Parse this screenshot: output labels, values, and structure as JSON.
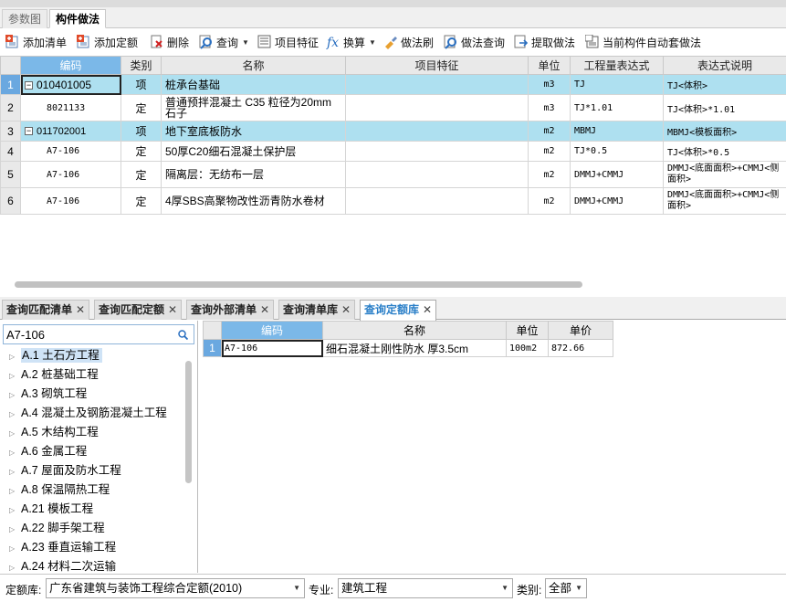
{
  "top_tabs": [
    "参数图",
    "构件做法"
  ],
  "toolbar": {
    "add_list": "添加清单",
    "add_quota": "添加定额",
    "delete": "删除",
    "query": "查询",
    "item_feature": "项目特征",
    "convert": "换算",
    "method_brush": "做法刷",
    "method_query": "做法查询",
    "extract_method": "提取做法",
    "auto_apply": "当前构件自动套做法"
  },
  "main_grid": {
    "columns": [
      "编码",
      "类别",
      "名称",
      "项目特征",
      "单位",
      "工程量表达式",
      "表达式说明"
    ],
    "rows": [
      {
        "num": "1",
        "code": "010401005",
        "type": "项",
        "name": "桩承台基础",
        "feature": "",
        "unit": "m3",
        "expr": "TJ",
        "desc": "TJ<体积>"
      },
      {
        "num": "2",
        "code": "8021133",
        "type": "定",
        "name": "普通预拌混凝土 C35 粒径为20mm石子",
        "feature": "",
        "unit": "m3",
        "expr": "TJ*1.01",
        "desc": "TJ<体积>*1.01"
      },
      {
        "num": "3",
        "code": "011702001",
        "type": "项",
        "name": "地下室底板防水",
        "feature": "",
        "unit": "m2",
        "expr": "MBMJ",
        "desc": "MBMJ<模板面积>"
      },
      {
        "num": "4",
        "code": "A7-106",
        "type": "定",
        "name": "50厚C20细石混凝土保护层",
        "feature": "",
        "unit": "m2",
        "expr": "TJ*0.5",
        "desc": "TJ<体积>*0.5"
      },
      {
        "num": "5",
        "code": "A7-106",
        "type": "定",
        "name": "隔离层：无纺布一层",
        "feature": "",
        "unit": "m2",
        "expr": "DMMJ+CMMJ",
        "desc": "DMMJ<底面面积>+CMMJ<侧面积>"
      },
      {
        "num": "6",
        "code": "A7-106",
        "type": "定",
        "name": "4厚SBS高聚物改性沥青防水卷材",
        "feature": "",
        "unit": "m2",
        "expr": "DMMJ+CMMJ",
        "desc": "DMMJ<底面面积>+CMMJ<侧面积>"
      }
    ]
  },
  "bottom_tabs": [
    "查询匹配清单",
    "查询匹配定额",
    "查询外部清单",
    "查询清单库",
    "查询定额库"
  ],
  "search": {
    "value": "A7-106"
  },
  "tree": [
    "A.1 土石方工程",
    "A.2 桩基础工程",
    "A.3 砌筑工程",
    "A.4 混凝土及钢筋混凝土工程",
    "A.5 木结构工程",
    "A.6 金属工程",
    "A.7 屋面及防水工程",
    "A.8 保温隔热工程",
    "A.21 模板工程",
    "A.22 脚手架工程",
    "A.23 垂直运输工程",
    "A.24 材料二次运输"
  ],
  "result_grid": {
    "columns": [
      "编码",
      "名称",
      "单位",
      "单价"
    ],
    "rows": [
      {
        "num": "1",
        "code": "A7-106",
        "name": "细石混凝土刚性防水 厚3.5cm",
        "unit": "100m2",
        "price": "872.66"
      }
    ]
  },
  "statusbar": {
    "quota_label": "定额库:",
    "quota_value": "广东省建筑与装饰工程综合定额(2010)",
    "major_label": "专业:",
    "major_value": "建筑工程",
    "category_label": "类别:",
    "category_value": "全部"
  }
}
